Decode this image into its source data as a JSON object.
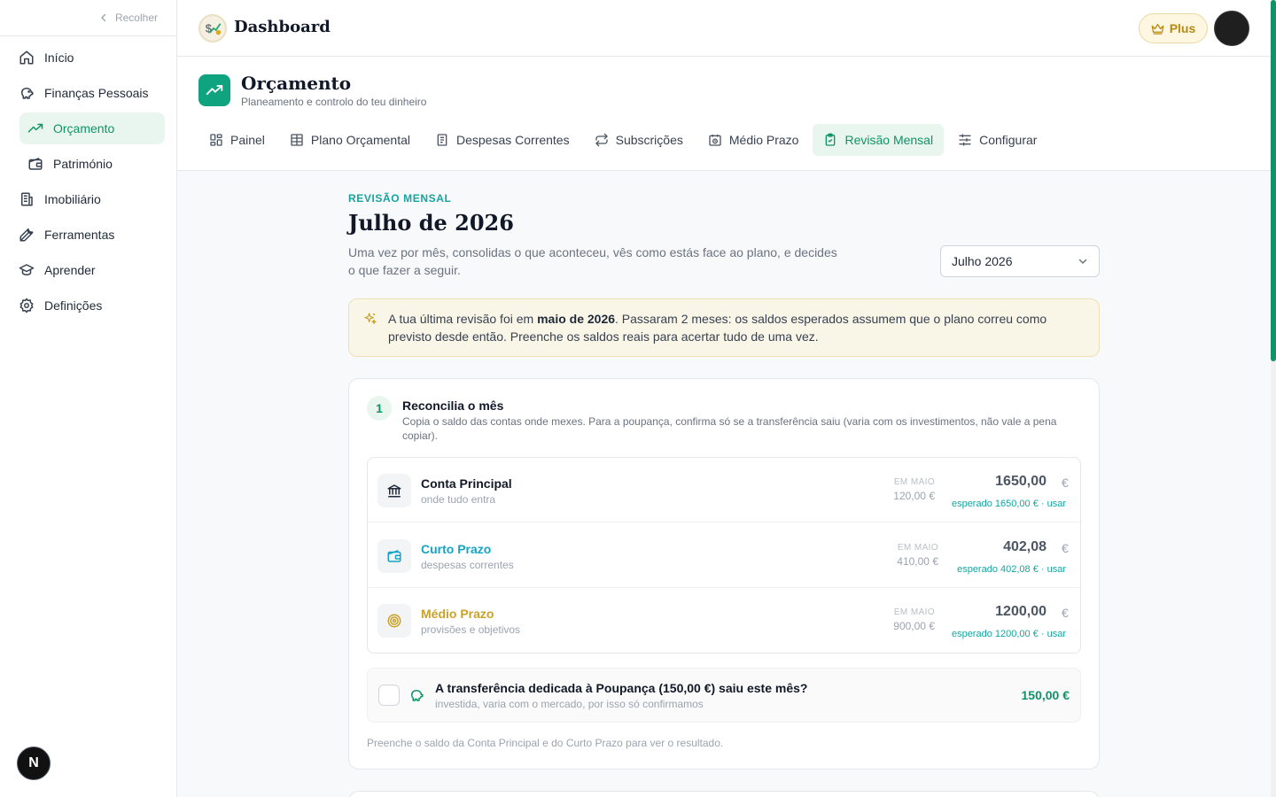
{
  "sidebar": {
    "collapse_label": "Recolher",
    "items": [
      {
        "label": "Início"
      },
      {
        "label": "Finanças Pessoais"
      },
      {
        "label": "Orçamento"
      },
      {
        "label": "Património"
      },
      {
        "label": "Imobiliário"
      },
      {
        "label": "Ferramentas"
      },
      {
        "label": "Aprender"
      },
      {
        "label": "Definições"
      }
    ],
    "active_item": "Orçamento",
    "badge_letter": "N"
  },
  "header": {
    "title": "Dashboard",
    "plus_label": "Plus"
  },
  "section": {
    "title": "Orçamento",
    "subtitle": "Planeamento e controlo do teu dinheiro",
    "tabs": [
      {
        "label": "Painel"
      },
      {
        "label": "Plano Orçamental"
      },
      {
        "label": "Despesas Correntes"
      },
      {
        "label": "Subscrições"
      },
      {
        "label": "Médio Prazo"
      },
      {
        "label": "Revisão Mensal"
      },
      {
        "label": "Configurar"
      }
    ],
    "active_tab": "Revisão Mensal"
  },
  "review": {
    "eyebrow": "REVISÃO MENSAL",
    "title": "Julho de 2026",
    "description": "Uma vez por mês, consolidas o que aconteceu, vês como estás face ao plano, e decides o que fazer a seguir.",
    "month_selected": "Julho 2026"
  },
  "notice": {
    "before": "A tua última revisão foi em ",
    "highlight": "maio de 2026",
    "after": ". Passaram 2 meses: os saldos esperados assumem que o plano correu como previsto desde então. Preenche os saldos reais para acertar tudo de uma vez."
  },
  "step1": {
    "number": "1",
    "title": "Reconcilia o mês",
    "description": "Copia o saldo das contas onde mexes. Para a poupança, confirma só se a transferência saiu (varia com os investimentos, não vale a pena copiar).",
    "accounts": [
      {
        "name": "Conta Principal",
        "sub": "onde tudo entra",
        "prev_label": "EM MAIO",
        "prev_value": "120,00 €",
        "amount": "1650,00",
        "currency": "€",
        "expected": "esperado 1650,00 € · usar",
        "color": "#111827"
      },
      {
        "name": "Curto Prazo",
        "sub": "despesas correntes",
        "prev_label": "EM MAIO",
        "prev_value": "410,00 €",
        "amount": "402,08",
        "currency": "€",
        "expected": "esperado 402,08 € · usar",
        "color": "#14a5c4"
      },
      {
        "name": "Médio Prazo",
        "sub": "provisões e objetivos",
        "prev_label": "EM MAIO",
        "prev_value": "900,00 €",
        "amount": "1200,00",
        "currency": "€",
        "expected": "esperado 1200,00 € · usar",
        "color": "#c9a227"
      }
    ],
    "transfer": {
      "title": "A transferência dedicada à Poupança (150,00 €) saiu este mês?",
      "sub": "investida, varia com o mercado, por isso só confirmamos",
      "amount": "150,00 €",
      "checked": false
    },
    "footer": "Preenche o saldo da Conta Principal e do Curto Prazo para ver o resultado."
  },
  "colors": {
    "accent": "#0f9467",
    "teal": "#14a5a0",
    "gold": "#c9a227"
  }
}
